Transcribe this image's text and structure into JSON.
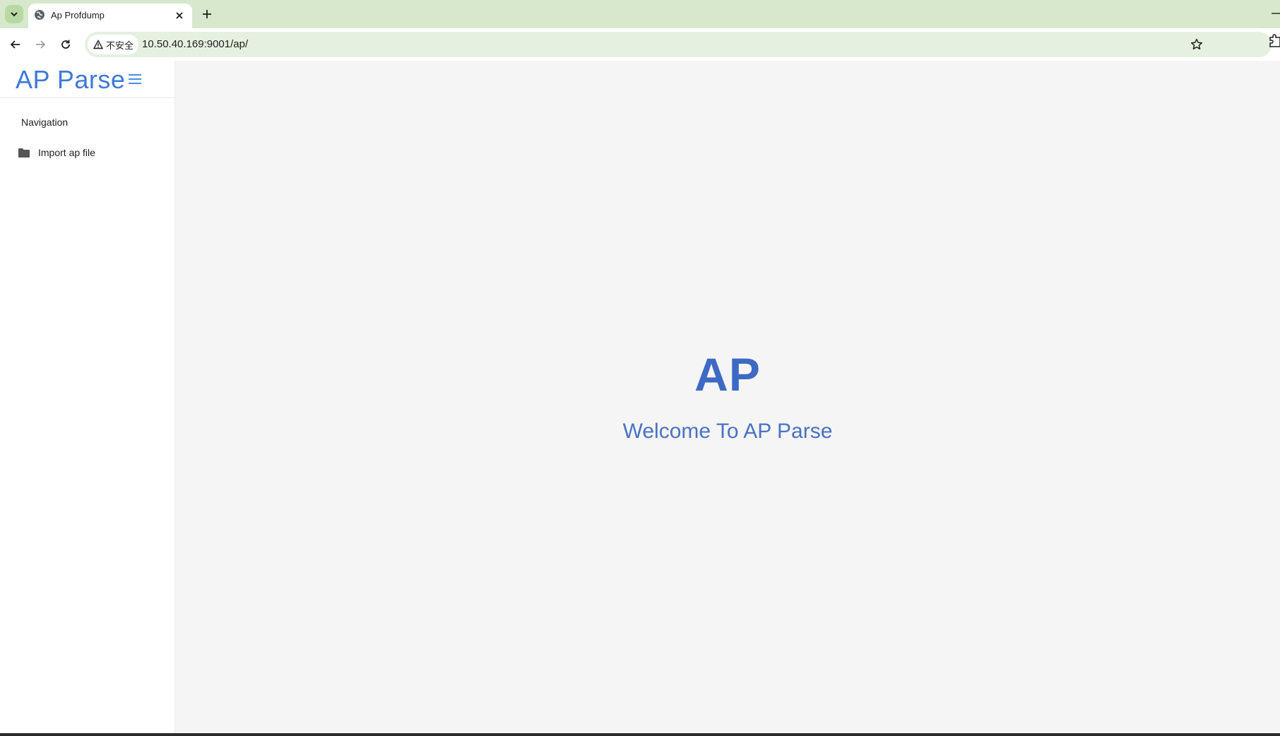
{
  "browser": {
    "tab_title": "Ap Profdump",
    "security_label": "不安全",
    "url": "10.50.40.169:9001/ap/"
  },
  "sidebar": {
    "brand": "AP Parse",
    "nav_heading": "Navigation",
    "items": [
      {
        "label": "Import ap file",
        "icon": "folder-icon"
      }
    ]
  },
  "main": {
    "logo_text": "AP",
    "welcome_text": "Welcome To AP Parse"
  },
  "colors": {
    "accent": "#3f79d8",
    "tabbar_bg": "#d7e8cd",
    "omnibox_bg": "#e6f0e0"
  }
}
